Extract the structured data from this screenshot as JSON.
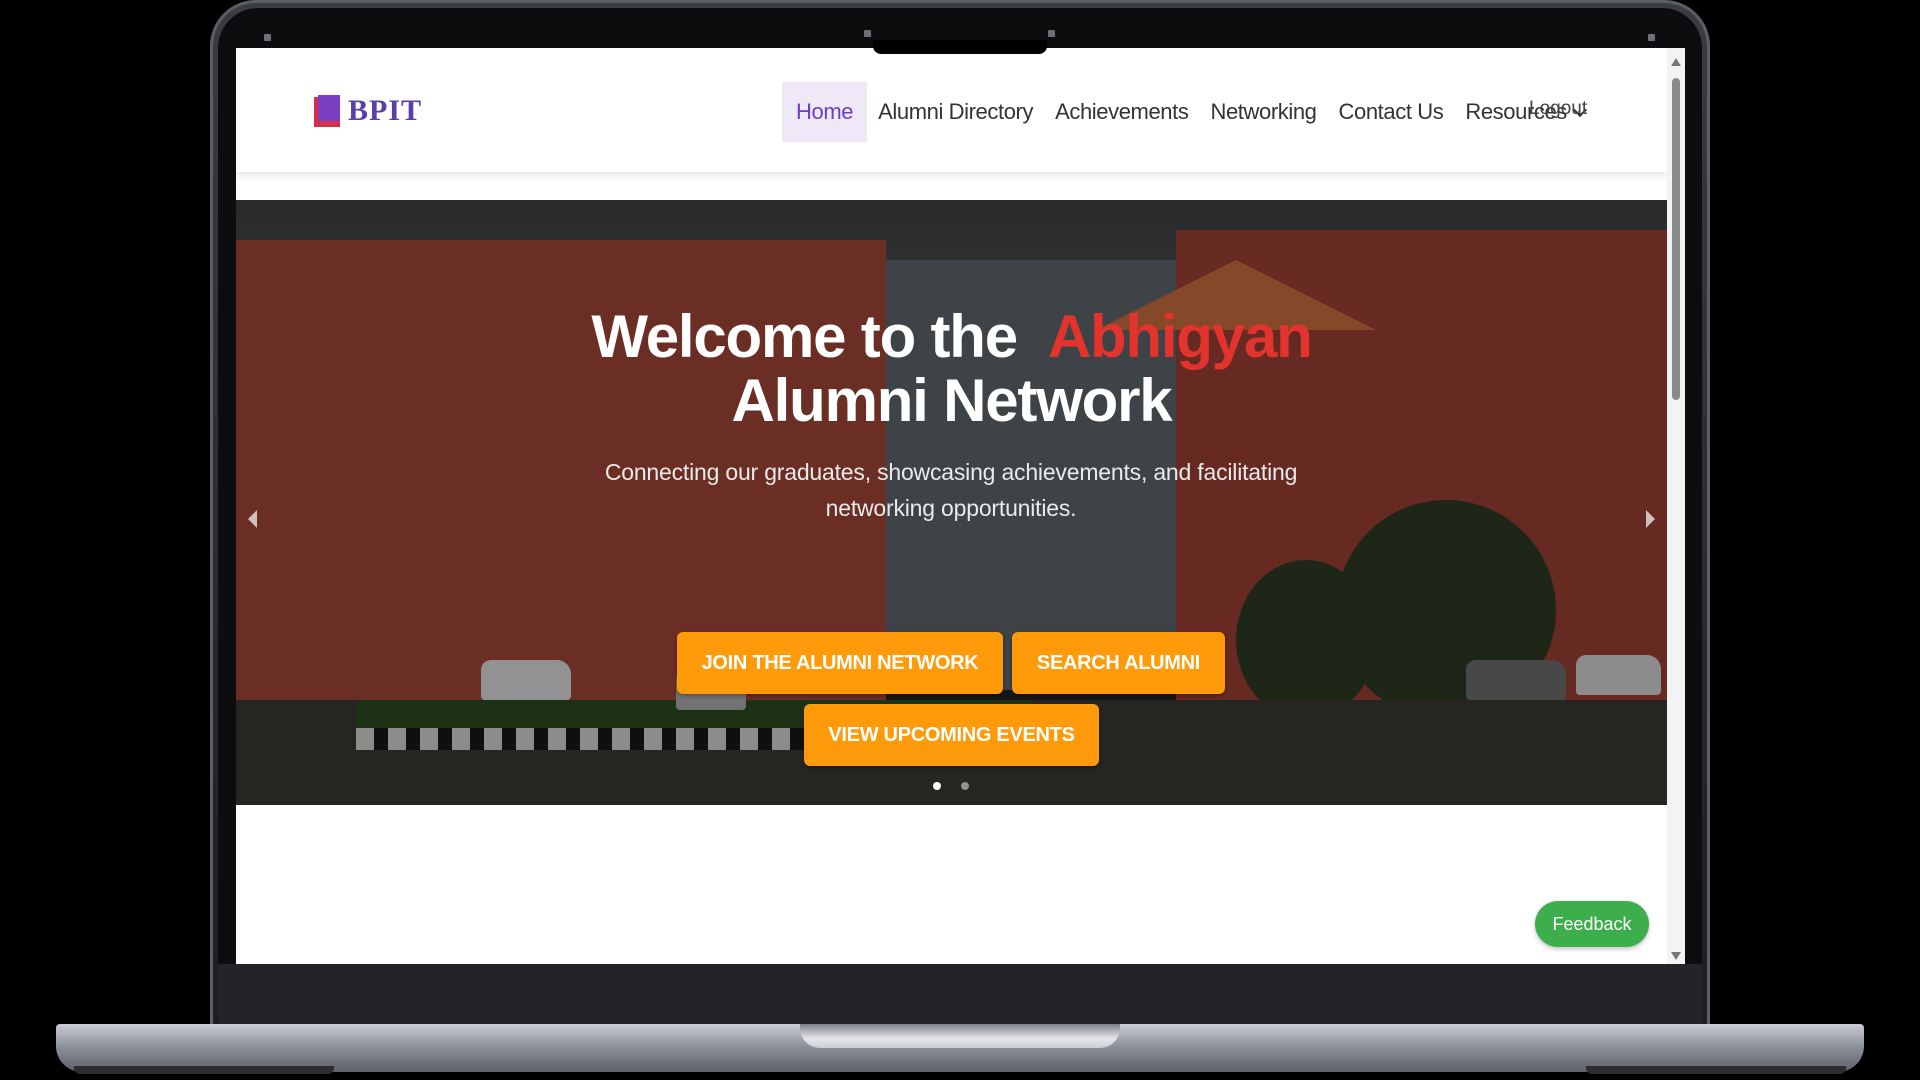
{
  "brand": {
    "name": "BPIT"
  },
  "nav": {
    "items": [
      {
        "label": "Home",
        "active": true
      },
      {
        "label": "Alumni Directory"
      },
      {
        "label": "Achievements"
      },
      {
        "label": "Networking"
      },
      {
        "label": "Contact Us"
      },
      {
        "label": "Resources"
      }
    ],
    "logout_label": "Logout"
  },
  "hero": {
    "title_prefix": "Welcome to the",
    "title_accent": "Abhigyan",
    "title_suffix": "Alumni Network",
    "subtitle": "Connecting our graduates, showcasing achievements, and facilitating networking opportunities.",
    "buttons": {
      "join": "JOIN THE ALUMNI NETWORK",
      "search": "SEARCH ALUMNI",
      "events": "VIEW UPCOMING EVENTS"
    },
    "slides_total": 2,
    "active_slide": 1
  },
  "feedback_label": "Feedback",
  "colors": {
    "accent_orange": "#ff9a0a",
    "accent_red": "#e2342d",
    "brand_purple": "#6b3fc4",
    "feedback_green": "#3cae4b"
  },
  "icons": [
    "book-logo-icon",
    "chevron-down-icon",
    "carousel-prev-icon",
    "carousel-next-icon"
  ]
}
